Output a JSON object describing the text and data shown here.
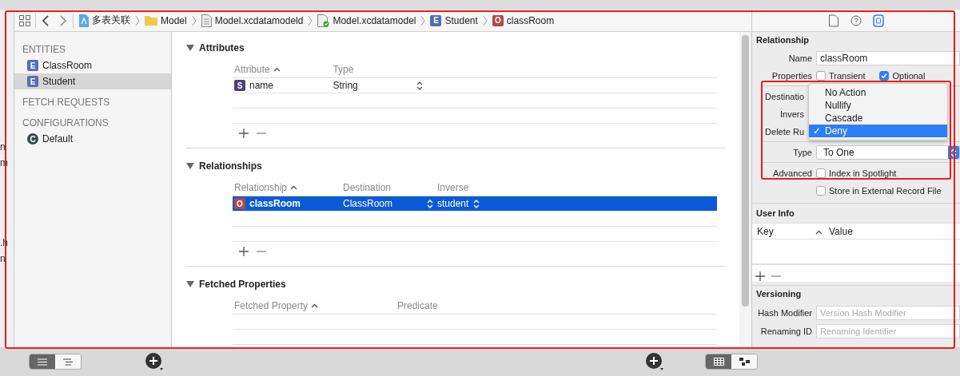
{
  "background_window": {
    "fragments": [
      "n",
      "m",
      ".h",
      "n"
    ]
  },
  "toolbar": {
    "breadcrumbs": [
      {
        "label": "多表关联",
        "kind": "project"
      },
      {
        "label": "Model",
        "kind": "folder"
      },
      {
        "label": "Model.xcdatamodeld",
        "kind": "document"
      },
      {
        "label": "Model.xcdatamodel",
        "kind": "model"
      },
      {
        "label": "Student",
        "kind": "badge",
        "badge": "E",
        "color": "#5a6bb5"
      },
      {
        "label": "classRoom",
        "kind": "badge",
        "badge": "O",
        "color": "#b3474e"
      }
    ]
  },
  "sidebar": {
    "sections": [
      {
        "title": "ENTITIES",
        "items": [
          {
            "label": "ClassRoom",
            "badge": "E",
            "color": "#5a6bb5",
            "selected": false
          },
          {
            "label": "Student",
            "badge": "E",
            "color": "#5a6bb5",
            "selected": true
          }
        ]
      },
      {
        "title": "FETCH REQUESTS"
      },
      {
        "title": "CONFIGURATIONS",
        "items": [
          {
            "label": "Default",
            "badge": "C",
            "color": "#3f4a4c",
            "selected": false
          }
        ]
      }
    ]
  },
  "editor": {
    "sections": [
      {
        "title": "Attributes",
        "expanded": true,
        "columns": [
          {
            "label": "Attribute",
            "sorted": true
          },
          {
            "label": "Type",
            "sorted": false
          }
        ],
        "rows": [
          {
            "selected": false,
            "cells": [
              {
                "text": "name",
                "badge": "S",
                "color": "#4d3f7a"
              },
              {
                "text": "String",
                "popup": true
              }
            ]
          }
        ],
        "add_remove": true
      },
      {
        "title": "Relationships",
        "expanded": true,
        "columns": [
          {
            "label": "Relationship",
            "sorted": true
          },
          {
            "label": "Destination",
            "sorted": false
          },
          {
            "label": "Inverse",
            "sorted": false
          }
        ],
        "rows": [
          {
            "selected": true,
            "cells": [
              {
                "text": "classRoom",
                "badge": "O",
                "color": "#b3474e"
              },
              {
                "text": "ClassRoom",
                "popup": true
              },
              {
                "text": "student",
                "popup": true
              }
            ]
          }
        ],
        "add_remove": true
      },
      {
        "title": "Fetched Properties",
        "expanded": true,
        "columns": [
          {
            "label": "Fetched Property",
            "sorted": true
          },
          {
            "label": "Predicate",
            "sorted": false
          }
        ],
        "add_remove": false
      }
    ]
  },
  "inspector": {
    "tabs": [
      {
        "kind": "file",
        "selected": false
      },
      {
        "kind": "help",
        "selected": false
      },
      {
        "kind": "model",
        "selected": true
      }
    ],
    "title": "Relationship",
    "name": {
      "label": "Name",
      "value": "classRoom"
    },
    "properties": {
      "label": "Properties",
      "options": [
        {
          "label": "Transient",
          "checked": false
        },
        {
          "label": "Optional",
          "checked": true
        }
      ]
    },
    "covered_labels": [
      "Destinatio",
      "Invers",
      "Delete Ru"
    ],
    "type": {
      "label": "Type",
      "value": "To One"
    },
    "advanced": {
      "label": "Advanced",
      "options": [
        {
          "label": "Index in Spotlight",
          "checked": false
        },
        {
          "label": "Store in External Record File",
          "checked": false
        }
      ]
    },
    "user_info": {
      "title": "User Info",
      "columns": [
        {
          "label": "Key",
          "sorted": true
        },
        {
          "label": "Value",
          "sorted": false
        }
      ]
    },
    "versioning": {
      "title": "Versioning",
      "fields": [
        {
          "label": "Hash Modifier",
          "placeholder": "Version Hash Modifier"
        },
        {
          "label": "Renaming ID",
          "placeholder": "Renaming Identifier"
        }
      ]
    }
  },
  "delete_rule_menu": {
    "items": [
      {
        "label": "No Action",
        "selected": false
      },
      {
        "label": "Nullify",
        "selected": false
      },
      {
        "label": "Cascade",
        "selected": false
      },
      {
        "label": "Deny",
        "selected": true
      }
    ],
    "check": "✓"
  },
  "bottom_bar": {
    "outline_style": [
      {
        "kind": "list",
        "selected": true
      },
      {
        "kind": "outline",
        "selected": false
      }
    ],
    "editor_style": [
      {
        "kind": "table",
        "selected": true
      },
      {
        "kind": "graph",
        "selected": false
      }
    ]
  }
}
